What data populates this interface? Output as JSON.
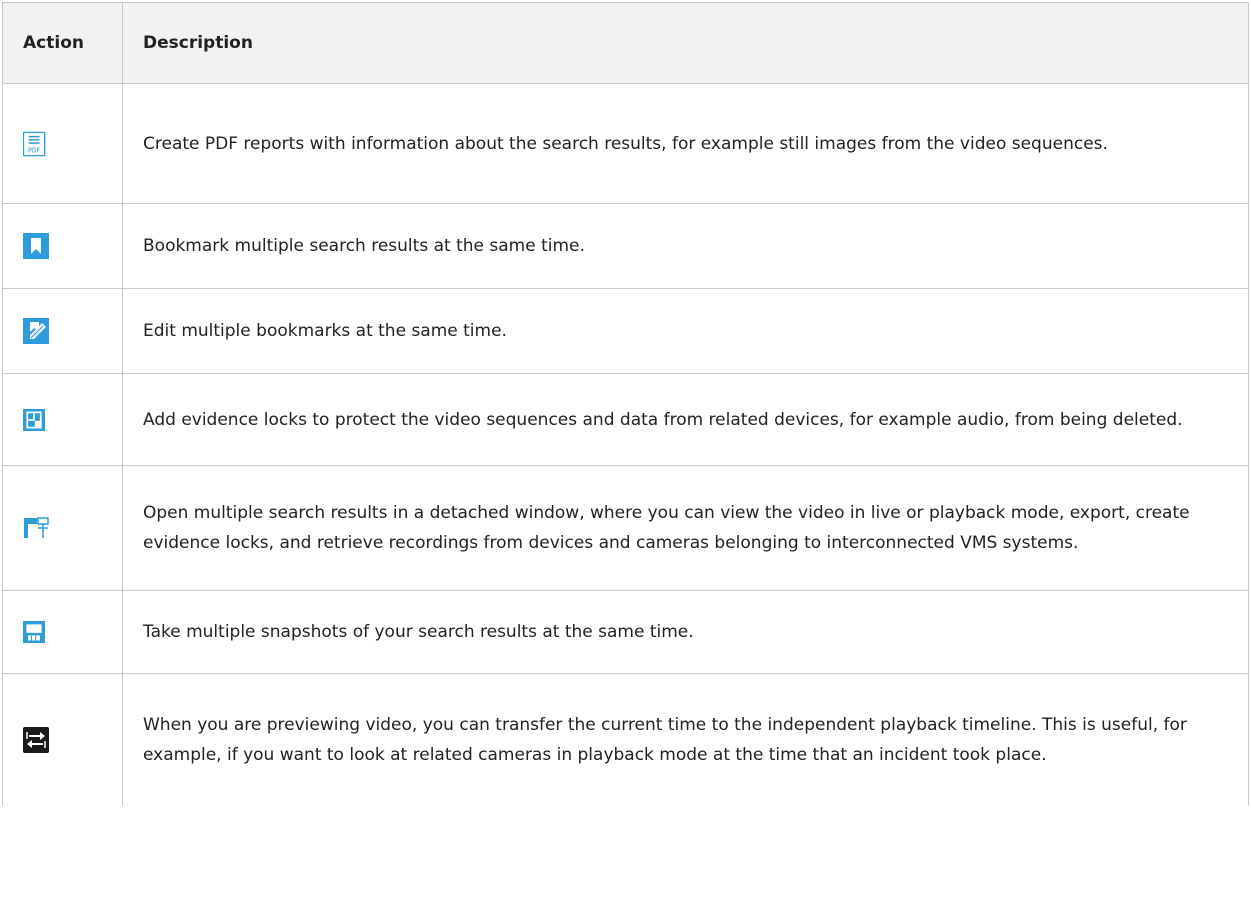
{
  "headers": {
    "action": "Action",
    "description": "Description"
  },
  "rows": [
    {
      "icon": "pdf-report-icon",
      "description": "Create PDF reports with information about the search results, for example still images from the video sequences."
    },
    {
      "icon": "bookmark-icon",
      "description": "Bookmark multiple search results at the same time."
    },
    {
      "icon": "edit-bookmark-icon",
      "description": "Edit multiple bookmarks at the same time."
    },
    {
      "icon": "evidence-lock-icon",
      "description": "Add evidence locks to protect the video sequences and data from related devices, for example audio, from being deleted."
    },
    {
      "icon": "detached-window-icon",
      "description": "Open multiple search results in a detached window, where you can view the video in live or playback mode, export, create evidence locks, and retrieve recordings from devices and cameras belonging to interconnected VMS systems."
    },
    {
      "icon": "snapshot-icon",
      "description": "Take multiple snapshots of your search results at the same time."
    },
    {
      "icon": "transfer-time-icon",
      "description": "When you are previewing video, you can transfer the current time to the independent playback timeline. This is useful, for example, if you want to look at related cameras in playback mode at the time that an incident took place."
    }
  ],
  "colors": {
    "icon_blue": "#2e9cdb",
    "icon_dark": "#1a1a1a",
    "header_bg": "#f2f2f2",
    "border": "#c8c8c8"
  }
}
